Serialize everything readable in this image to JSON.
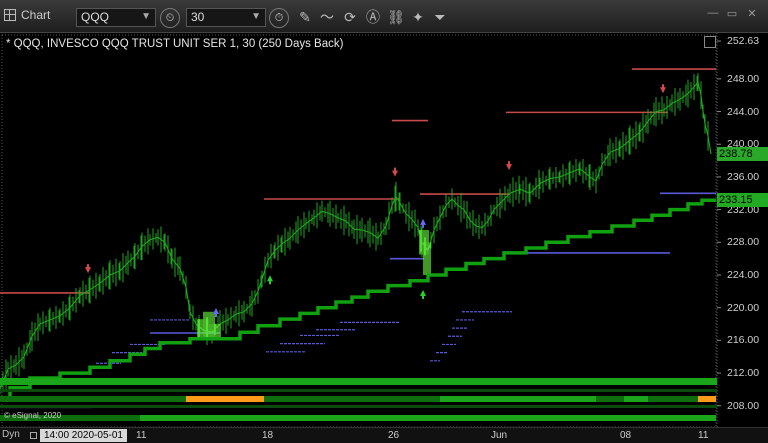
{
  "toolbar": {
    "tab_label": "Chart",
    "symbol_value": "QQQ",
    "interval_value": "30"
  },
  "chart_title": "* QQQ, INVESCO QQQ TRUST UNIT SER 1, 30 (250 Days Back)",
  "copyright": "© eSignal, 2020",
  "bottom": {
    "mode_label": "Dyn",
    "cursor_date": "14:00 2020-05-01"
  },
  "colors": {
    "price": "#1fa51f",
    "stop_line": "#10a010",
    "resistance": "#c84a4a",
    "support": "#5a5ad8",
    "last_price_bg": "#2aa82a",
    "stop_bg": "#22aa22"
  },
  "chart_data": {
    "type": "line",
    "y_axis": {
      "ylim": [
        206.5,
        253
      ],
      "ticks": [
        "252.63",
        "248.00",
        "244.00",
        "240.00",
        "236.00",
        "232.00",
        "228.00",
        "224.00",
        "220.00",
        "216.00",
        "212.00",
        "208.00"
      ]
    },
    "x_ticks": [
      "11",
      "18",
      "26",
      "Jun",
      "08",
      "11"
    ],
    "price_labels": [
      {
        "text": "238.78",
        "value": 238.78,
        "role": "last-price"
      },
      {
        "text": "233.15",
        "value": 233.15,
        "role": "trailing-stop"
      }
    ],
    "price": [
      [
        0,
        210.0
      ],
      [
        8,
        212.5
      ],
      [
        16,
        213.0
      ],
      [
        24,
        214.0
      ],
      [
        32,
        216.5
      ],
      [
        40,
        218.0
      ],
      [
        50,
        218.5
      ],
      [
        60,
        219.0
      ],
      [
        70,
        220.0
      ],
      [
        80,
        221.5
      ],
      [
        90,
        222.2
      ],
      [
        100,
        223.0
      ],
      [
        110,
        224.0
      ],
      [
        120,
        224.5
      ],
      [
        128,
        225.5
      ],
      [
        135,
        226.3
      ],
      [
        142,
        227.5
      ],
      [
        150,
        228.3
      ],
      [
        158,
        228.6
      ],
      [
        165,
        228.0
      ],
      [
        172,
        226.0
      ],
      [
        180,
        224.8
      ],
      [
        186,
        222.5
      ],
      [
        190,
        219.5
      ],
      [
        196,
        218.0
      ],
      [
        204,
        217.2
      ],
      [
        212,
        217.0
      ],
      [
        220,
        218.0
      ],
      [
        228,
        218.5
      ],
      [
        236,
        219.2
      ],
      [
        244,
        219.5
      ],
      [
        252,
        220.5
      ],
      [
        258,
        222.0
      ],
      [
        262,
        223.5
      ],
      [
        268,
        225.8
      ],
      [
        275,
        227.0
      ],
      [
        282,
        227.8
      ],
      [
        290,
        228.5
      ],
      [
        298,
        229.5
      ],
      [
        306,
        230.3
      ],
      [
        314,
        231.0
      ],
      [
        322,
        231.8
      ],
      [
        330,
        231.5
      ],
      [
        338,
        231.0
      ],
      [
        346,
        230.6
      ],
      [
        354,
        229.6
      ],
      [
        362,
        229.5
      ],
      [
        370,
        229.2
      ],
      [
        378,
        228.5
      ],
      [
        386,
        230.0
      ],
      [
        392,
        232.5
      ],
      [
        396,
        233.6
      ],
      [
        400,
        232.8
      ],
      [
        406,
        231.5
      ],
      [
        412,
        230.8
      ],
      [
        418,
        229.8
      ],
      [
        422,
        228.0
      ],
      [
        428,
        227.0
      ],
      [
        434,
        229.5
      ],
      [
        440,
        231.0
      ],
      [
        446,
        232.5
      ],
      [
        452,
        233.3
      ],
      [
        458,
        232.5
      ],
      [
        464,
        232.0
      ],
      [
        470,
        230.7
      ],
      [
        476,
        230.0
      ],
      [
        482,
        229.8
      ],
      [
        488,
        230.6
      ],
      [
        494,
        232.0
      ],
      [
        502,
        233.0
      ],
      [
        510,
        234.0
      ],
      [
        520,
        234.5
      ],
      [
        530,
        234.0
      ],
      [
        540,
        235.2
      ],
      [
        550,
        235.8
      ],
      [
        560,
        236.0
      ],
      [
        570,
        236.5
      ],
      [
        580,
        237.0
      ],
      [
        590,
        236.0
      ],
      [
        596,
        235.5
      ],
      [
        602,
        237.5
      ],
      [
        610,
        239.0
      ],
      [
        620,
        239.5
      ],
      [
        630,
        240.5
      ],
      [
        640,
        241.5
      ],
      [
        648,
        242.8
      ],
      [
        656,
        244.0
      ],
      [
        664,
        244.2
      ],
      [
        672,
        245.0
      ],
      [
        680,
        245.5
      ],
      [
        688,
        246.2
      ],
      [
        694,
        247.0
      ],
      [
        698,
        247.6
      ],
      [
        701,
        246.0
      ],
      [
        703,
        244.0
      ],
      [
        705,
        242.5
      ],
      [
        708,
        241.0
      ],
      [
        711,
        238.8
      ]
    ],
    "stop_line_steps": [
      [
        0,
        209.0
      ],
      [
        10,
        209.0
      ],
      [
        10,
        210.2
      ],
      [
        30,
        210.2
      ],
      [
        30,
        211.4
      ],
      [
        60,
        211.4
      ],
      [
        60,
        212.0
      ],
      [
        90,
        212.0
      ],
      [
        90,
        212.7
      ],
      [
        110,
        212.7
      ],
      [
        110,
        213.5
      ],
      [
        130,
        213.5
      ],
      [
        130,
        214.3
      ],
      [
        145,
        214.3
      ],
      [
        145,
        215.0
      ],
      [
        160,
        215.0
      ],
      [
        160,
        215.7
      ],
      [
        190,
        215.7
      ],
      [
        190,
        216.2
      ],
      [
        240,
        216.2
      ],
      [
        240,
        217.0
      ],
      [
        258,
        217.0
      ],
      [
        258,
        217.8
      ],
      [
        280,
        217.8
      ],
      [
        280,
        218.6
      ],
      [
        300,
        218.6
      ],
      [
        300,
        219.3
      ],
      [
        318,
        219.3
      ],
      [
        318,
        220.0
      ],
      [
        336,
        220.0
      ],
      [
        336,
        220.7
      ],
      [
        352,
        220.7
      ],
      [
        352,
        221.3
      ],
      [
        368,
        221.3
      ],
      [
        368,
        222.0
      ],
      [
        388,
        222.0
      ],
      [
        388,
        222.7
      ],
      [
        410,
        222.7
      ],
      [
        410,
        223.3
      ],
      [
        428,
        223.3
      ],
      [
        428,
        224.0
      ],
      [
        446,
        224.0
      ],
      [
        446,
        224.7
      ],
      [
        466,
        224.7
      ],
      [
        466,
        225.4
      ],
      [
        484,
        225.4
      ],
      [
        484,
        226.0
      ],
      [
        504,
        226.0
      ],
      [
        504,
        226.7
      ],
      [
        526,
        226.7
      ],
      [
        526,
        227.3
      ],
      [
        546,
        227.3
      ],
      [
        546,
        228.0
      ],
      [
        568,
        228.0
      ],
      [
        568,
        228.7
      ],
      [
        590,
        228.7
      ],
      [
        590,
        229.3
      ],
      [
        612,
        229.3
      ],
      [
        612,
        230.0
      ],
      [
        634,
        230.0
      ],
      [
        634,
        230.7
      ],
      [
        652,
        230.7
      ],
      [
        652,
        231.3
      ],
      [
        670,
        231.3
      ],
      [
        670,
        232.0
      ],
      [
        688,
        232.0
      ],
      [
        688,
        232.7
      ],
      [
        702,
        232.7
      ],
      [
        702,
        233.15
      ],
      [
        716,
        233.15
      ]
    ],
    "resistance_levels": [
      {
        "x1": 0,
        "x2": 90,
        "y": 221.8
      },
      {
        "x1": 264,
        "x2": 400,
        "y": 233.3
      },
      {
        "x1": 392,
        "x2": 428,
        "y": 242.9
      },
      {
        "x1": 420,
        "x2": 510,
        "y": 233.9
      },
      {
        "x1": 506,
        "x2": 668,
        "y": 243.9
      },
      {
        "x1": 632,
        "x2": 716,
        "y": 249.2
      }
    ],
    "support_levels": [
      {
        "x1": 150,
        "x2": 220,
        "y": 216.9
      },
      {
        "x1": 390,
        "x2": 424,
        "y": 226.0
      },
      {
        "x1": 506,
        "x2": 670,
        "y": 226.7
      },
      {
        "x1": 660,
        "x2": 716,
        "y": 234.0
      },
      {
        "x1": 0,
        "x2": 92,
        "y": 207.8
      }
    ],
    "down_arrows": [
      {
        "x": 88,
        "y": 224.6
      },
      {
        "x": 395,
        "y": 236.4
      },
      {
        "x": 509,
        "y": 237.2
      },
      {
        "x": 663,
        "y": 246.6
      }
    ],
    "up_arrows_support": [
      {
        "x": 216,
        "y": 219.6
      },
      {
        "x": 423,
        "y": 230.5
      }
    ],
    "up_arrows_bull": [
      {
        "x": 270,
        "y": 223.6
      },
      {
        "x": 423,
        "y": 221.8
      }
    ]
  }
}
